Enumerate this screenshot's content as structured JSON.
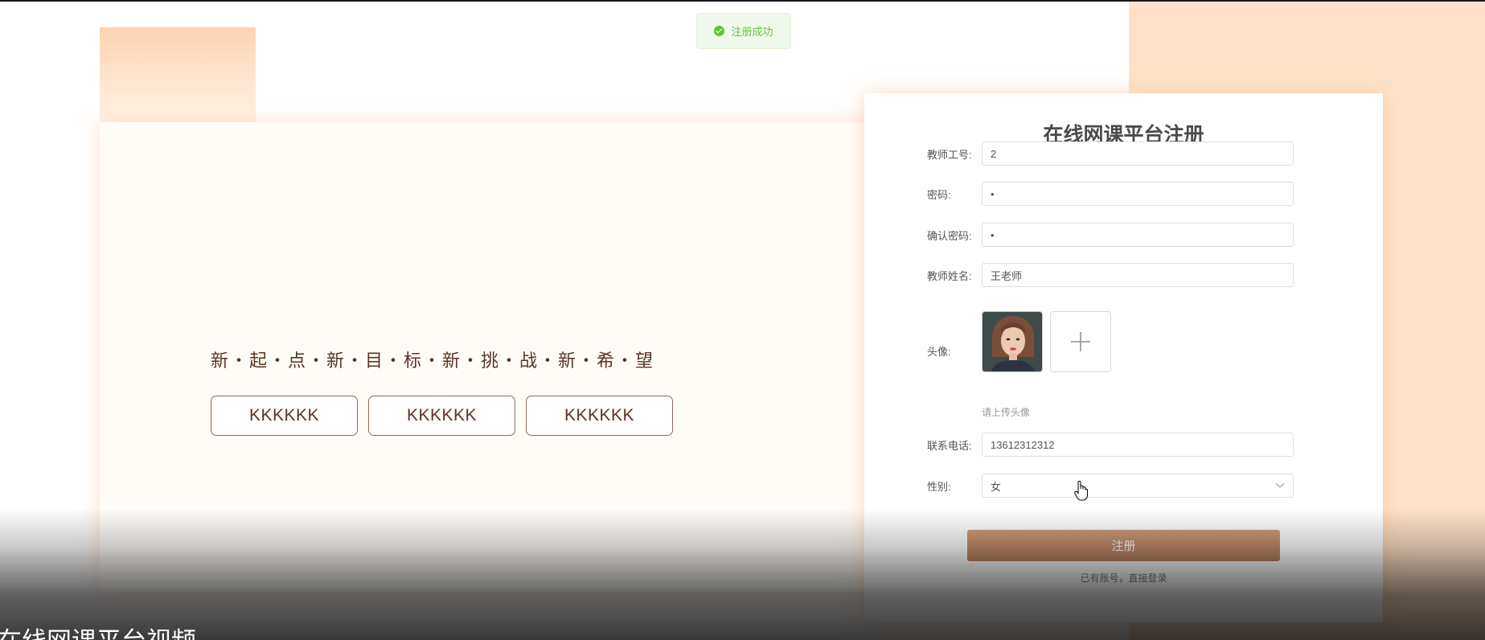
{
  "toast": {
    "message": "注册成功",
    "icon": "success-check-icon",
    "color": "#67c23a"
  },
  "hero": {
    "slogan": "新・起・点・新・目・标・新・挑・战・新・希・望",
    "buttons": [
      "KKKKKK",
      "KKKKKK",
      "KKKKKK"
    ]
  },
  "form": {
    "title": "在线网课平台注册",
    "teacher_id": {
      "label": "教师工号:",
      "value": "2"
    },
    "password": {
      "label": "密码:",
      "value": "•"
    },
    "confirm_password": {
      "label": "确认密码:",
      "value": "•"
    },
    "teacher_name": {
      "label": "教师姓名:",
      "value": "王老师"
    },
    "avatar": {
      "label": "头像:",
      "hint": "请上传头像",
      "add_icon": "plus-icon"
    },
    "phone": {
      "label": "联系电话:",
      "value": "13612312312"
    },
    "gender": {
      "label": "性别:",
      "value": "女",
      "icon": "chevron-down-icon"
    },
    "submit_label": "注册",
    "login_link": "已有账号，直接登录"
  },
  "video": {
    "title": "在线网课平台视频"
  },
  "colors": {
    "accent": "#b58160",
    "deco_peach": "#fde2c9",
    "slogan_text": "#5b3426"
  }
}
